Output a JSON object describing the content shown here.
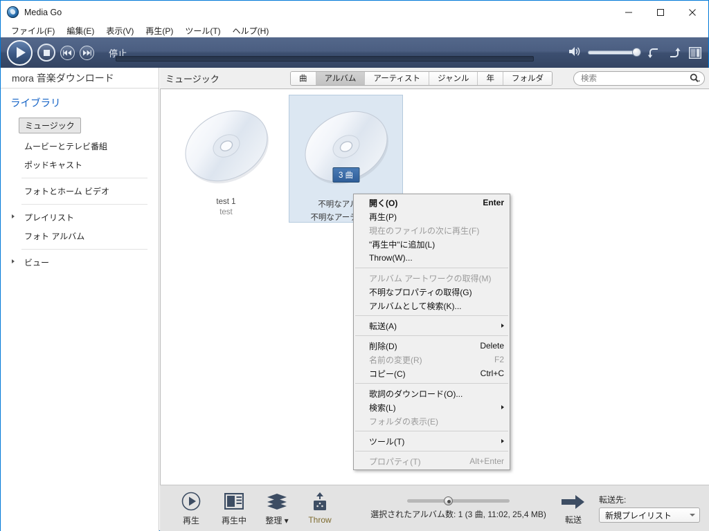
{
  "window": {
    "title": "Media Go",
    "app_icon": "media-go-icon",
    "controls": {
      "minimize": "minimize-icon",
      "maximize": "maximize-icon",
      "close": "close-icon"
    }
  },
  "menubar": {
    "items": [
      {
        "label": "ファイル(F)"
      },
      {
        "label": "編集(E)"
      },
      {
        "label": "表示(V)"
      },
      {
        "label": "再生(P)"
      },
      {
        "label": "ツール(T)"
      },
      {
        "label": "ヘルプ(H)"
      }
    ]
  },
  "player": {
    "status": "停止",
    "play_icon": "play-icon",
    "stop_icon": "stop-icon",
    "previous_icon": "previous-track-icon",
    "next_icon": "next-track-icon",
    "volume_icon": "volume-icon",
    "repeat_icon": "repeat-icon",
    "shuffle_icon": "shuffle-icon",
    "visualizer_icon": "visualizer-icon",
    "volume_value": 100,
    "seek_value": 0
  },
  "sidebar": {
    "mora_link": "mora 音楽ダウンロード",
    "library_heading": "ライブラリ",
    "items": [
      {
        "label": "ミュージック",
        "selected": true
      },
      {
        "label": "ムービーとテレビ番組",
        "selected": false
      },
      {
        "label": "ポッドキャスト",
        "selected": false
      },
      {
        "label": "フォトとホーム ビデオ",
        "selected": false
      },
      {
        "label": "プレイリスト",
        "selected": false,
        "expandable": true
      },
      {
        "label": "フォト アルバム",
        "selected": false
      },
      {
        "label": "ビュー",
        "selected": false,
        "expandable": true
      }
    ]
  },
  "content": {
    "title": "ミュージック",
    "tabs": [
      {
        "label": "曲",
        "active": false
      },
      {
        "label": "アルバム",
        "active": true
      },
      {
        "label": "アーティスト",
        "active": false
      },
      {
        "label": "ジャンル",
        "active": false
      },
      {
        "label": "年",
        "active": false
      },
      {
        "label": "フォルダ",
        "active": false
      }
    ],
    "search": {
      "placeholder": "検索",
      "value": "",
      "icon": "search-icon"
    },
    "albums": [
      {
        "name": "test 1",
        "artist": "test",
        "selected": false,
        "badge": ""
      },
      {
        "name": "不明なアルバム",
        "artist": "不明なアーティスト",
        "selected": true,
        "badge": "3 曲"
      }
    ]
  },
  "context_menu": {
    "groups": [
      [
        {
          "label": "開く(O)",
          "accel": "Enter",
          "bold": true,
          "disabled": false,
          "submenu": false
        },
        {
          "label": "再生(P)",
          "accel": "",
          "bold": false,
          "disabled": false,
          "submenu": false
        },
        {
          "label": "現在のファイルの次に再生(F)",
          "accel": "",
          "bold": false,
          "disabled": true,
          "submenu": false
        },
        {
          "label": "\"再生中\"に追加(L)",
          "accel": "",
          "bold": false,
          "disabled": false,
          "submenu": false
        },
        {
          "label": "Throw(W)...",
          "accel": "",
          "bold": false,
          "disabled": false,
          "submenu": false
        }
      ],
      [
        {
          "label": "アルバム アートワークの取得(M)",
          "accel": "",
          "bold": false,
          "disabled": true,
          "submenu": false
        },
        {
          "label": "不明なプロパティの取得(G)",
          "accel": "",
          "bold": false,
          "disabled": false,
          "submenu": false
        },
        {
          "label": "アルバムとして検索(K)...",
          "accel": "",
          "bold": false,
          "disabled": false,
          "submenu": false
        }
      ],
      [
        {
          "label": "転送(A)",
          "accel": "",
          "bold": false,
          "disabled": false,
          "submenu": true
        }
      ],
      [
        {
          "label": "削除(D)",
          "accel": "Delete",
          "bold": false,
          "disabled": false,
          "submenu": false
        },
        {
          "label": "名前の変更(R)",
          "accel": "F2",
          "bold": false,
          "disabled": true,
          "submenu": false
        },
        {
          "label": "コピー(C)",
          "accel": "Ctrl+C",
          "bold": false,
          "disabled": false,
          "submenu": false
        }
      ],
      [
        {
          "label": "歌詞のダウンロード(O)...",
          "accel": "",
          "bold": false,
          "disabled": false,
          "submenu": false
        },
        {
          "label": "検索(L)",
          "accel": "",
          "bold": false,
          "disabled": false,
          "submenu": true
        },
        {
          "label": "フォルダの表示(E)",
          "accel": "",
          "bold": false,
          "disabled": true,
          "submenu": false
        }
      ],
      [
        {
          "label": "ツール(T)",
          "accel": "",
          "bold": false,
          "disabled": false,
          "submenu": true
        }
      ],
      [
        {
          "label": "プロパティ(T)",
          "accel": "Alt+Enter",
          "bold": false,
          "disabled": true,
          "submenu": false
        }
      ]
    ]
  },
  "bottom_bar": {
    "buttons": [
      {
        "label": "再生",
        "icon": "play-circle-icon",
        "highlight": false
      },
      {
        "label": "再生中",
        "icon": "now-playing-icon",
        "highlight": false
      },
      {
        "label": "整理 ▾",
        "icon": "organize-icon",
        "highlight": false
      },
      {
        "label": "Throw",
        "icon": "throw-icon",
        "highlight": true
      }
    ],
    "status_text": "選択されたアルバム数: 1 (3 曲, 11:02, 25,4 MB)",
    "zoom_value": 36,
    "transfer": {
      "button_label": "転送",
      "icon": "transfer-arrow-icon",
      "destination_label": "転送先:",
      "destination_value": "新規プレイリスト"
    }
  },
  "colors": {
    "accent_blue": "#0078d7",
    "toolbar_top": "#54688b",
    "toolbar_bottom": "#344462",
    "link_blue": "#1463c6",
    "selection_blue": "#dce7f2",
    "badge_blue": "#2f5e99"
  }
}
